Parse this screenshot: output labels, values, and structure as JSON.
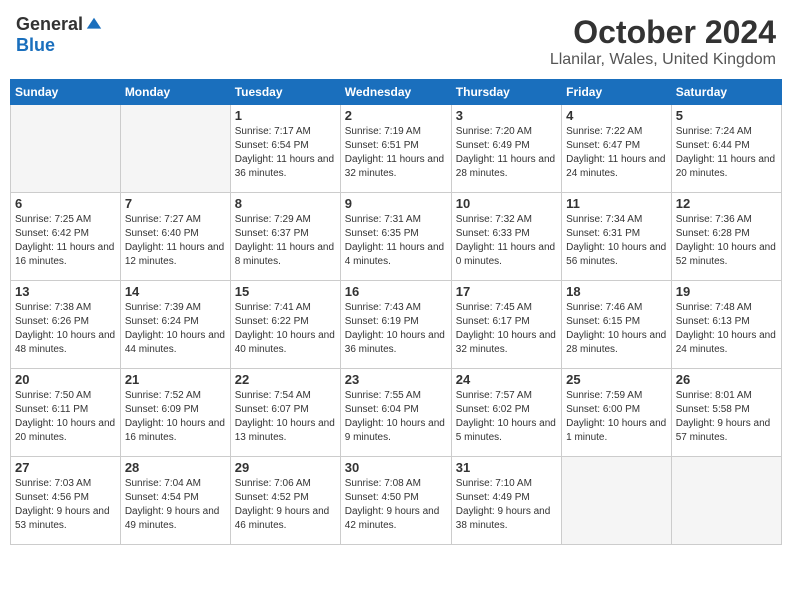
{
  "header": {
    "logo_general": "General",
    "logo_blue": "Blue",
    "month_year": "October 2024",
    "location": "Llanilar, Wales, United Kingdom"
  },
  "weekdays": [
    "Sunday",
    "Monday",
    "Tuesday",
    "Wednesday",
    "Thursday",
    "Friday",
    "Saturday"
  ],
  "weeks": [
    [
      {
        "day": "",
        "sunrise": "",
        "sunset": "",
        "daylight": ""
      },
      {
        "day": "",
        "sunrise": "",
        "sunset": "",
        "daylight": ""
      },
      {
        "day": "1",
        "sunrise": "Sunrise: 7:17 AM",
        "sunset": "Sunset: 6:54 PM",
        "daylight": "Daylight: 11 hours and 36 minutes."
      },
      {
        "day": "2",
        "sunrise": "Sunrise: 7:19 AM",
        "sunset": "Sunset: 6:51 PM",
        "daylight": "Daylight: 11 hours and 32 minutes."
      },
      {
        "day": "3",
        "sunrise": "Sunrise: 7:20 AM",
        "sunset": "Sunset: 6:49 PM",
        "daylight": "Daylight: 11 hours and 28 minutes."
      },
      {
        "day": "4",
        "sunrise": "Sunrise: 7:22 AM",
        "sunset": "Sunset: 6:47 PM",
        "daylight": "Daylight: 11 hours and 24 minutes."
      },
      {
        "day": "5",
        "sunrise": "Sunrise: 7:24 AM",
        "sunset": "Sunset: 6:44 PM",
        "daylight": "Daylight: 11 hours and 20 minutes."
      }
    ],
    [
      {
        "day": "6",
        "sunrise": "Sunrise: 7:25 AM",
        "sunset": "Sunset: 6:42 PM",
        "daylight": "Daylight: 11 hours and 16 minutes."
      },
      {
        "day": "7",
        "sunrise": "Sunrise: 7:27 AM",
        "sunset": "Sunset: 6:40 PM",
        "daylight": "Daylight: 11 hours and 12 minutes."
      },
      {
        "day": "8",
        "sunrise": "Sunrise: 7:29 AM",
        "sunset": "Sunset: 6:37 PM",
        "daylight": "Daylight: 11 hours and 8 minutes."
      },
      {
        "day": "9",
        "sunrise": "Sunrise: 7:31 AM",
        "sunset": "Sunset: 6:35 PM",
        "daylight": "Daylight: 11 hours and 4 minutes."
      },
      {
        "day": "10",
        "sunrise": "Sunrise: 7:32 AM",
        "sunset": "Sunset: 6:33 PM",
        "daylight": "Daylight: 11 hours and 0 minutes."
      },
      {
        "day": "11",
        "sunrise": "Sunrise: 7:34 AM",
        "sunset": "Sunset: 6:31 PM",
        "daylight": "Daylight: 10 hours and 56 minutes."
      },
      {
        "day": "12",
        "sunrise": "Sunrise: 7:36 AM",
        "sunset": "Sunset: 6:28 PM",
        "daylight": "Daylight: 10 hours and 52 minutes."
      }
    ],
    [
      {
        "day": "13",
        "sunrise": "Sunrise: 7:38 AM",
        "sunset": "Sunset: 6:26 PM",
        "daylight": "Daylight: 10 hours and 48 minutes."
      },
      {
        "day": "14",
        "sunrise": "Sunrise: 7:39 AM",
        "sunset": "Sunset: 6:24 PM",
        "daylight": "Daylight: 10 hours and 44 minutes."
      },
      {
        "day": "15",
        "sunrise": "Sunrise: 7:41 AM",
        "sunset": "Sunset: 6:22 PM",
        "daylight": "Daylight: 10 hours and 40 minutes."
      },
      {
        "day": "16",
        "sunrise": "Sunrise: 7:43 AM",
        "sunset": "Sunset: 6:19 PM",
        "daylight": "Daylight: 10 hours and 36 minutes."
      },
      {
        "day": "17",
        "sunrise": "Sunrise: 7:45 AM",
        "sunset": "Sunset: 6:17 PM",
        "daylight": "Daylight: 10 hours and 32 minutes."
      },
      {
        "day": "18",
        "sunrise": "Sunrise: 7:46 AM",
        "sunset": "Sunset: 6:15 PM",
        "daylight": "Daylight: 10 hours and 28 minutes."
      },
      {
        "day": "19",
        "sunrise": "Sunrise: 7:48 AM",
        "sunset": "Sunset: 6:13 PM",
        "daylight": "Daylight: 10 hours and 24 minutes."
      }
    ],
    [
      {
        "day": "20",
        "sunrise": "Sunrise: 7:50 AM",
        "sunset": "Sunset: 6:11 PM",
        "daylight": "Daylight: 10 hours and 20 minutes."
      },
      {
        "day": "21",
        "sunrise": "Sunrise: 7:52 AM",
        "sunset": "Sunset: 6:09 PM",
        "daylight": "Daylight: 10 hours and 16 minutes."
      },
      {
        "day": "22",
        "sunrise": "Sunrise: 7:54 AM",
        "sunset": "Sunset: 6:07 PM",
        "daylight": "Daylight: 10 hours and 13 minutes."
      },
      {
        "day": "23",
        "sunrise": "Sunrise: 7:55 AM",
        "sunset": "Sunset: 6:04 PM",
        "daylight": "Daylight: 10 hours and 9 minutes."
      },
      {
        "day": "24",
        "sunrise": "Sunrise: 7:57 AM",
        "sunset": "Sunset: 6:02 PM",
        "daylight": "Daylight: 10 hours and 5 minutes."
      },
      {
        "day": "25",
        "sunrise": "Sunrise: 7:59 AM",
        "sunset": "Sunset: 6:00 PM",
        "daylight": "Daylight: 10 hours and 1 minute."
      },
      {
        "day": "26",
        "sunrise": "Sunrise: 8:01 AM",
        "sunset": "Sunset: 5:58 PM",
        "daylight": "Daylight: 9 hours and 57 minutes."
      }
    ],
    [
      {
        "day": "27",
        "sunrise": "Sunrise: 7:03 AM",
        "sunset": "Sunset: 4:56 PM",
        "daylight": "Daylight: 9 hours and 53 minutes."
      },
      {
        "day": "28",
        "sunrise": "Sunrise: 7:04 AM",
        "sunset": "Sunset: 4:54 PM",
        "daylight": "Daylight: 9 hours and 49 minutes."
      },
      {
        "day": "29",
        "sunrise": "Sunrise: 7:06 AM",
        "sunset": "Sunset: 4:52 PM",
        "daylight": "Daylight: 9 hours and 46 minutes."
      },
      {
        "day": "30",
        "sunrise": "Sunrise: 7:08 AM",
        "sunset": "Sunset: 4:50 PM",
        "daylight": "Daylight: 9 hours and 42 minutes."
      },
      {
        "day": "31",
        "sunrise": "Sunrise: 7:10 AM",
        "sunset": "Sunset: 4:49 PM",
        "daylight": "Daylight: 9 hours and 38 minutes."
      },
      {
        "day": "",
        "sunrise": "",
        "sunset": "",
        "daylight": ""
      },
      {
        "day": "",
        "sunrise": "",
        "sunset": "",
        "daylight": ""
      }
    ]
  ]
}
